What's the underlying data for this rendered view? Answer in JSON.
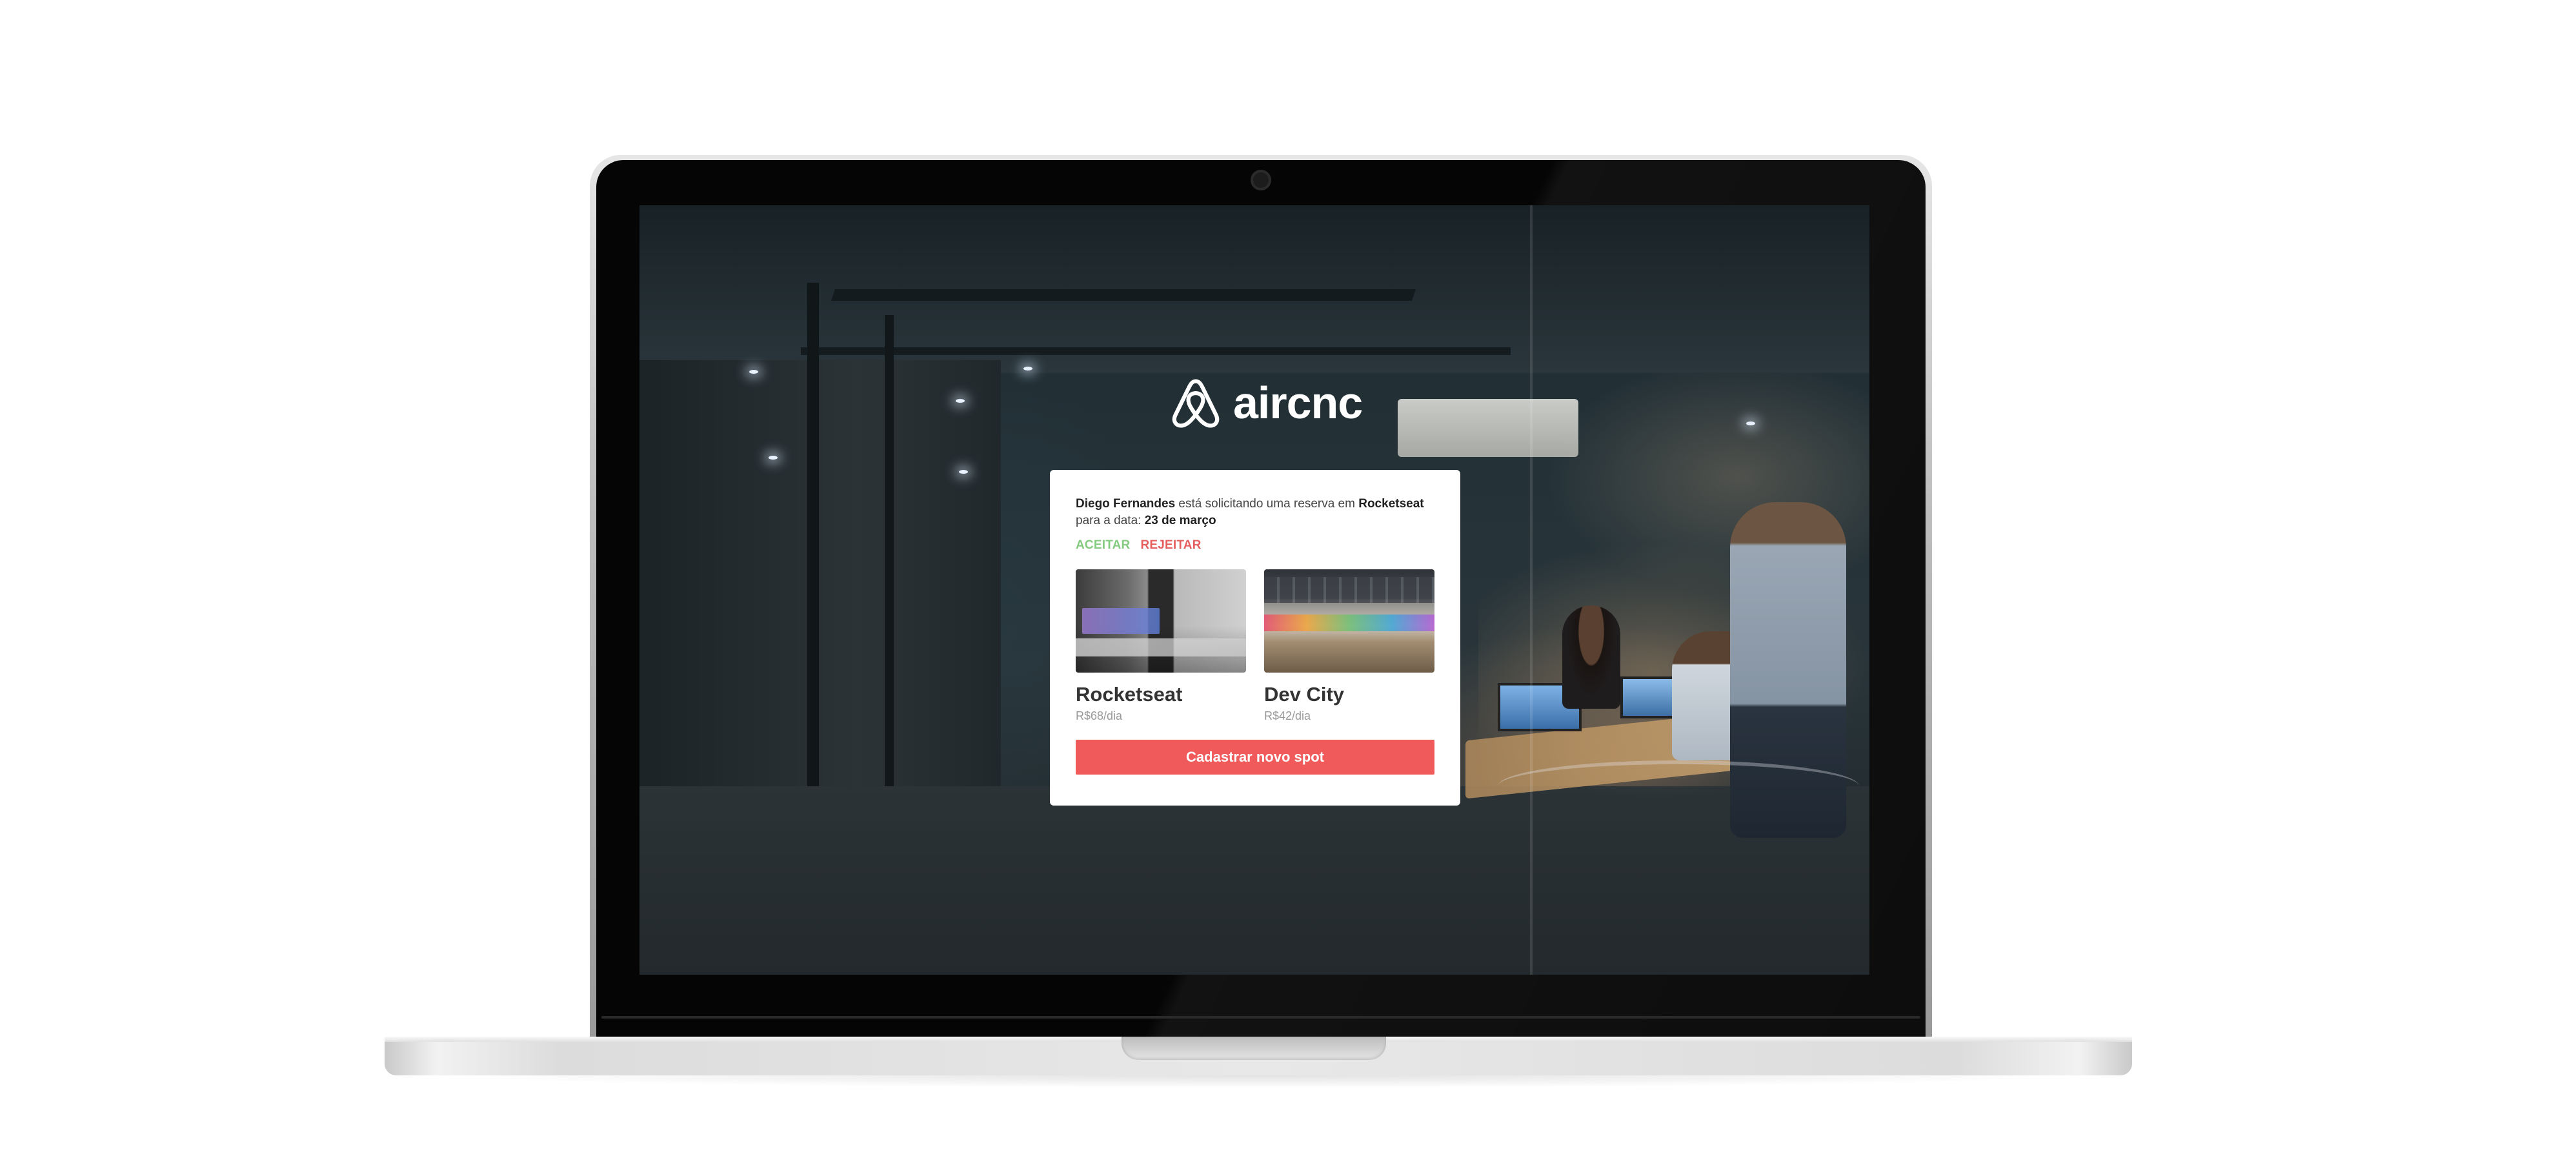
{
  "app": {
    "logo_text": "aircnc",
    "logo_icon": "airbnb-belo-icon"
  },
  "notification": {
    "user": "Diego Fernandes",
    "text_middle": " está solicitando uma reserva em ",
    "spot": "Rocketseat",
    "text_date_prefix": "para a data: ",
    "date": "23 de março",
    "accept_label": "ACEITAR",
    "reject_label": "REJEITAR"
  },
  "spots": [
    {
      "name": "Rocketseat",
      "price": "R$68/dia"
    },
    {
      "name": "Dev City",
      "price": "R$42/dia"
    }
  ],
  "new_spot_button": "Cadastrar novo spot",
  "colors": {
    "accept": "#84cb80",
    "reject": "#e55e5e",
    "primary": "#f05a5b"
  }
}
